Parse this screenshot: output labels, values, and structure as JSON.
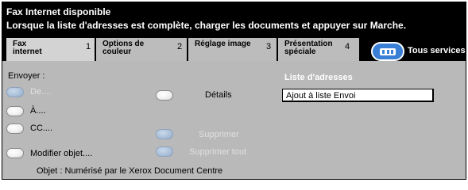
{
  "header": {
    "line1": "Fax Internet disponible",
    "line2": "Lorsque la liste d'adresses est complète, charger les documents et appuyer sur Marche."
  },
  "tabs": [
    {
      "label_l1": "Fax",
      "label_l2": "internet",
      "number": "1"
    },
    {
      "label_l1": "Options de",
      "label_l2": "couleur",
      "number": "2"
    },
    {
      "label_l1": "Réglage image",
      "label_l2": "",
      "number": "3"
    },
    {
      "label_l1": "Présentation",
      "label_l2": "spéciale",
      "number": "4"
    }
  ],
  "all_services": {
    "label": "Tous services"
  },
  "send": {
    "label": "Envoyer :",
    "from": "De....",
    "to": "À....",
    "cc": "CC....",
    "modify_subject": "Modifier objet...."
  },
  "actions": {
    "details": "Détails",
    "delete": "Supprimer",
    "delete_all": "Supprimer tout"
  },
  "address_list": {
    "title": "Liste d'adresses",
    "value": "Ajout à liste Envoi"
  },
  "subject_line": "Objet : Numérisé par le Xerox Document Centre",
  "colors": {
    "header_bg": "#000000",
    "panel_bg": "#b9b9b9",
    "tab_active": "#d3d3d3",
    "accent_blue": "#3a7fd6"
  }
}
